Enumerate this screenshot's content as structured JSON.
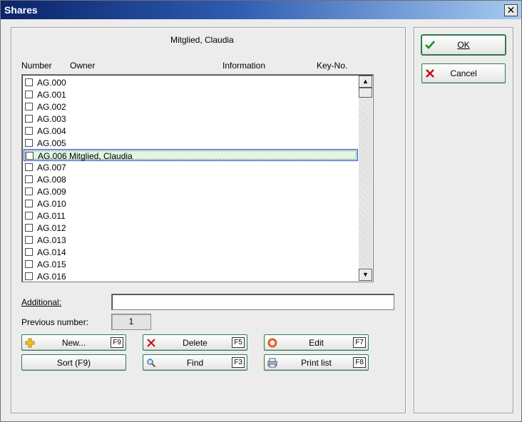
{
  "window": {
    "title": "Shares",
    "close_glyph": "✕"
  },
  "owner_caption": "Mitglied, Claudia",
  "columns": [
    "Number",
    "Owner",
    "Information",
    "Key-No."
  ],
  "rows": [
    {
      "number": "AG.000",
      "owner": ""
    },
    {
      "number": "AG.001",
      "owner": ""
    },
    {
      "number": "AG.002",
      "owner": ""
    },
    {
      "number": "AG.003",
      "owner": ""
    },
    {
      "number": "AG.004",
      "owner": ""
    },
    {
      "number": "AG.005",
      "owner": ""
    },
    {
      "number": "AG.006",
      "owner": "Mitglied, Claudia",
      "selected": true
    },
    {
      "number": "AG.007",
      "owner": ""
    },
    {
      "number": "AG.008",
      "owner": ""
    },
    {
      "number": "AG.009",
      "owner": ""
    },
    {
      "number": "AG.010",
      "owner": ""
    },
    {
      "number": "AG.011",
      "owner": ""
    },
    {
      "number": "AG.012",
      "owner": ""
    },
    {
      "number": "AG.013",
      "owner": ""
    },
    {
      "number": "AG.014",
      "owner": ""
    },
    {
      "number": "AG.015",
      "owner": ""
    },
    {
      "number": "AG.016",
      "owner": ""
    }
  ],
  "fields": {
    "additional_label": "Additional:",
    "additional_value": "",
    "previous_label": "Previous number:",
    "previous_value": "1"
  },
  "buttons": {
    "new": {
      "label": "New...",
      "key": "F9",
      "icon": "plus-icon"
    },
    "delete": {
      "label": "Delete",
      "key": "F5",
      "icon": "delete-x-icon"
    },
    "edit": {
      "label": "Edit",
      "key": "F7",
      "icon": "edit-ring-icon"
    },
    "sort": {
      "label": "Sort (F9)"
    },
    "find": {
      "label": "Find",
      "key": "F3",
      "icon": "magnifier-icon"
    },
    "print": {
      "label": "Print list",
      "key": "F8",
      "icon": "printer-icon"
    },
    "ok": {
      "label": "OK",
      "icon": "checkmark-icon"
    },
    "cancel": {
      "label": "Cancel",
      "icon": "cancel-x-icon"
    }
  },
  "colors": {
    "title_start": "#0a246a",
    "selected_row_bg": "#e2f7dc",
    "selected_row_border": "#2f4cc8",
    "button_border": "#2e7a4e"
  }
}
